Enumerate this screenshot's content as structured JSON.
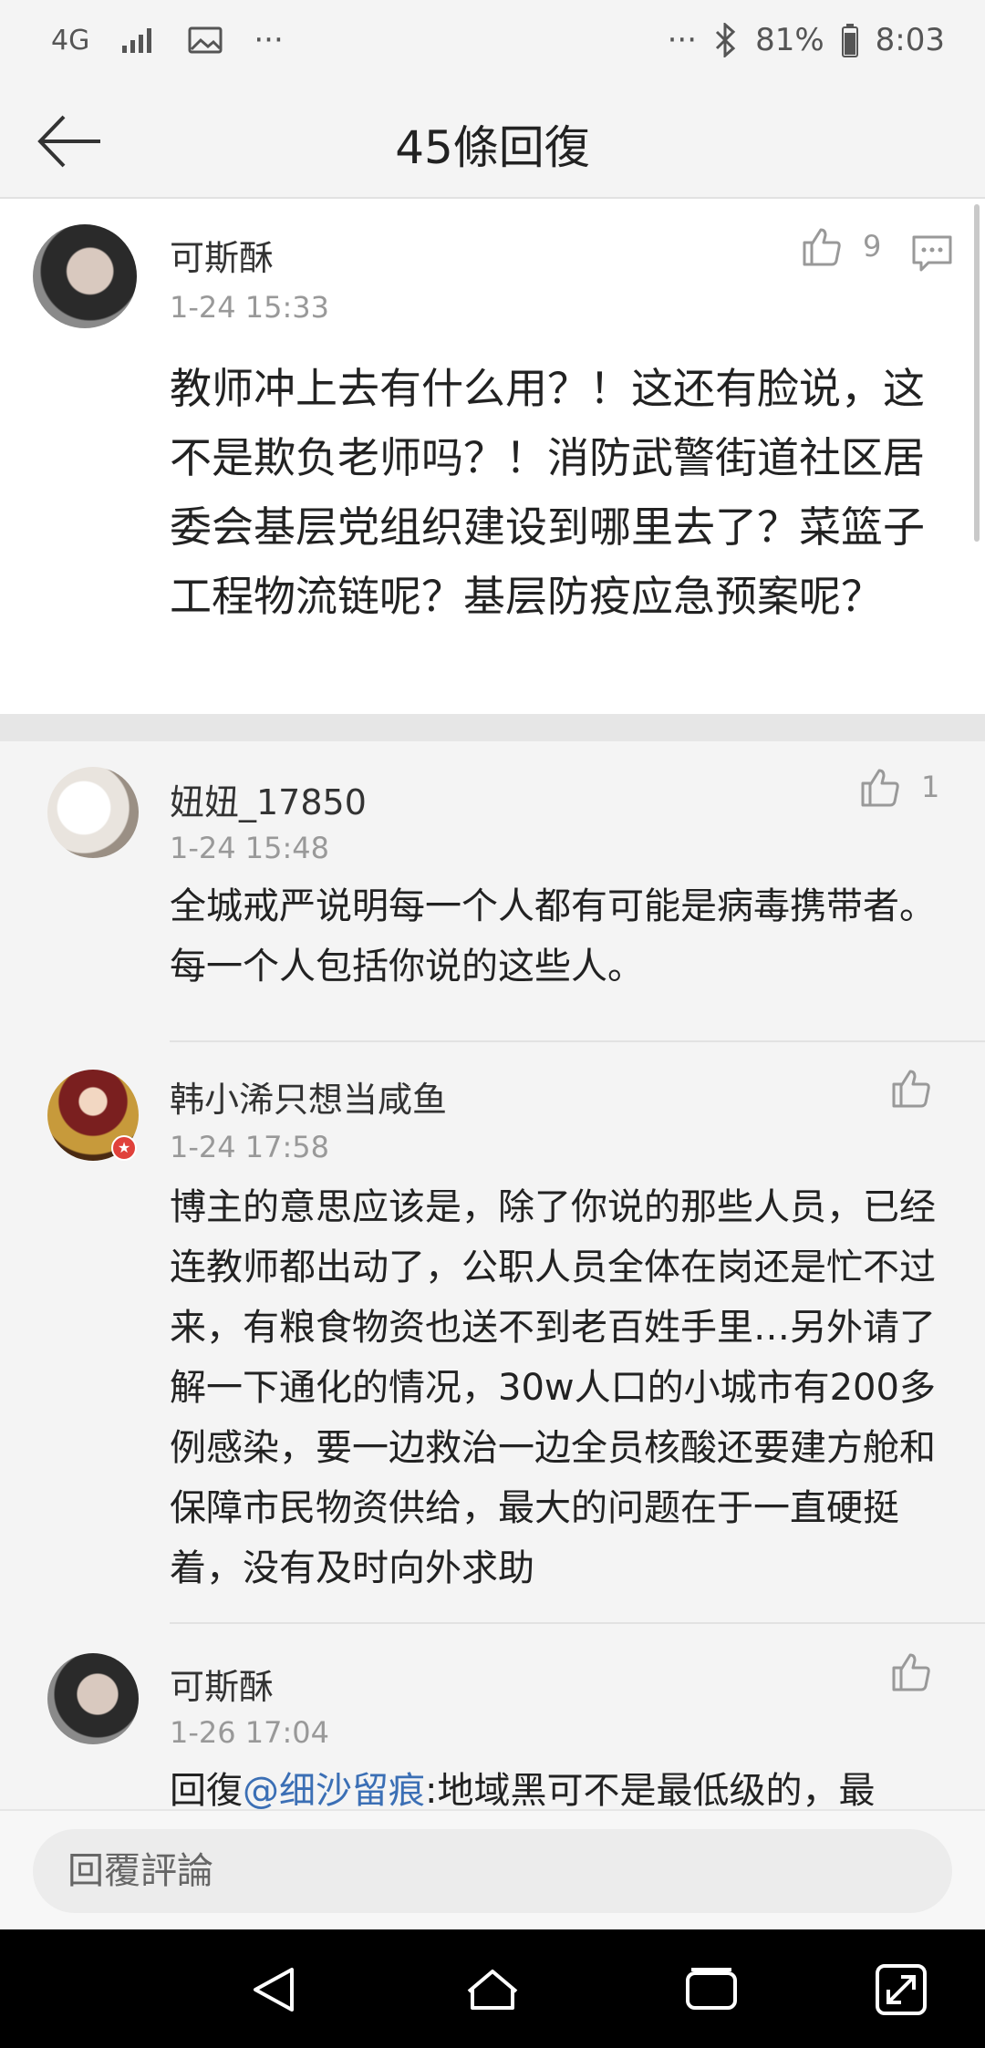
{
  "status_bar": {
    "network": "4G",
    "more_left": "···",
    "more_right": "···",
    "battery": "81%",
    "time": "8:03"
  },
  "header": {
    "title": "45條回復"
  },
  "main_comment": {
    "author": "可斯酥",
    "time": "1-24 15:33",
    "likes": "9",
    "text": "教师冲上去有什么用？！这还有脸说，这不是欺负老师吗？！消防武警街道社区居委会基层党组织建设到哪里去了？菜篮子工程物流链呢？基层防疫应急预案呢？"
  },
  "replies": [
    {
      "author": "妞妞_17850",
      "time": "1-24 15:48",
      "likes": "1",
      "text": "全城戒严说明每一个人都有可能是病毒携带者。每一个人包括你说的这些人。"
    },
    {
      "author": "韩小浠只想当咸鱼",
      "time": "1-24 17:58",
      "likes": "",
      "text": "博主的意思应该是，除了你说的那些人员，已经连教师都出动了，公职人员全体在岗还是忙不过来，有粮食物资也送不到老百姓手里…另外请了解一下通化的情况，30w人口的小城市有200多例感染，要一边救治一边全员核酸还要建方舱和保障市民物资供给，最大的问题在于一直硬挺着，没有及时向外求助"
    },
    {
      "author": "可斯酥",
      "time": "1-26 17:04",
      "likes": "",
      "reply_prefix": "回復",
      "mention": "@细沙留痕",
      "text": ":地域黑可不是最低级的，最"
    }
  ],
  "input": {
    "placeholder": "回覆評論"
  },
  "colors": {
    "link": "#3b6fb5",
    "background": "#f4f4f4",
    "nav": "#000000"
  }
}
